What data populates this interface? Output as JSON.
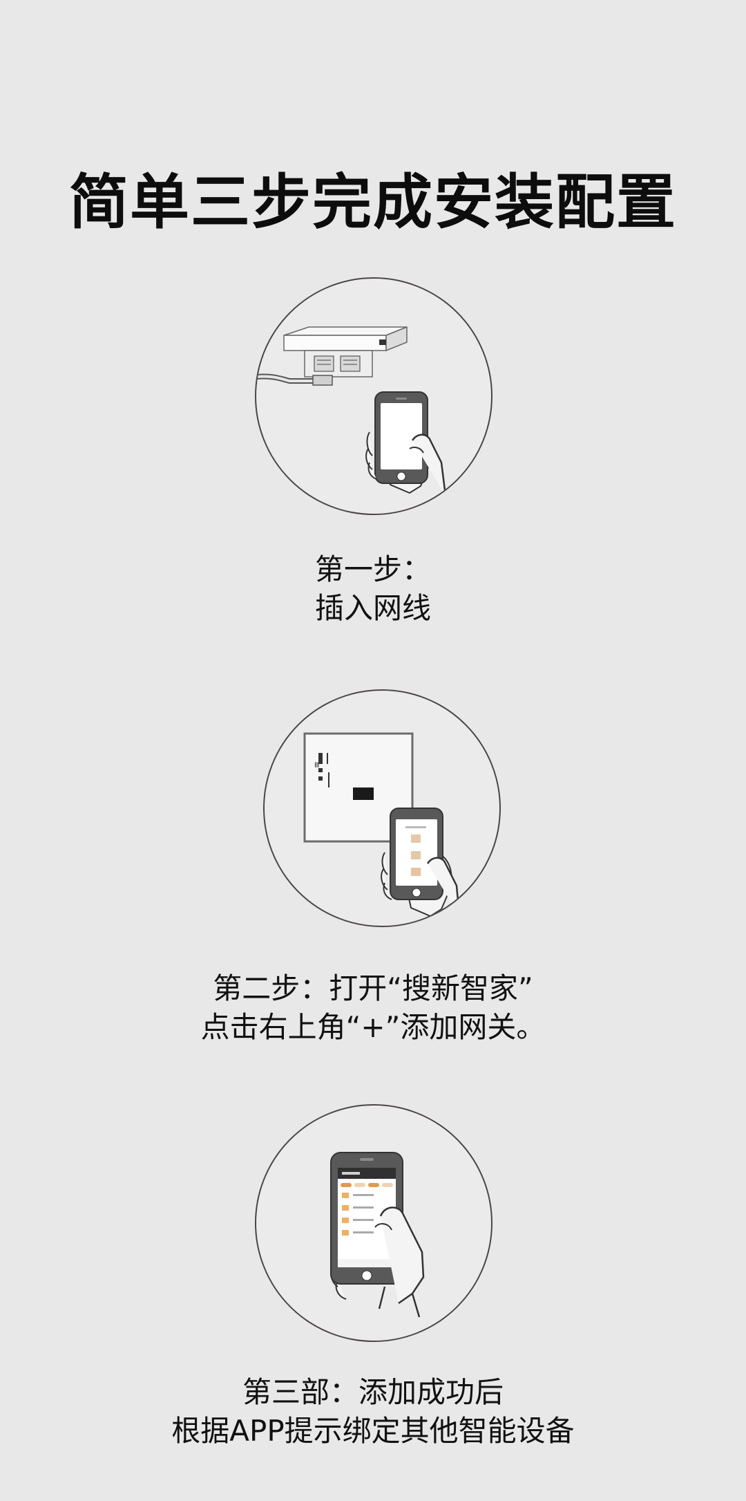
{
  "title": "简单三步完成安装配置",
  "steps": [
    {
      "line1": "第一步：",
      "line2": "插入网线"
    },
    {
      "line1": "第二步：打开“搜新智家”",
      "line2": "点击右上角“+”添加网关。"
    },
    {
      "line1": "第三部：添加成功后",
      "line2": "根据APP提示绑定其他智能设备"
    }
  ],
  "colors": {
    "background": "#e8e8e8",
    "circle_stroke": "#4a4543",
    "phone_body": "#595959",
    "text": "#111111"
  },
  "icons": [
    "gateway-device-illustration",
    "phone-in-hand-icon",
    "wall-switch-panel-illustration",
    "app-screen-phone-icon"
  ]
}
